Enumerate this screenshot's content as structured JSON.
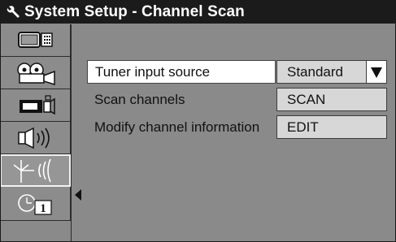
{
  "window": {
    "title": "System Setup - Channel Scan",
    "title_icon": "wrench-icon"
  },
  "sidebar": {
    "items": [
      {
        "name": "display-setup",
        "icon": "tv-screen-icon",
        "active": false
      },
      {
        "name": "projector-setup",
        "icon": "projector-icon",
        "active": false
      },
      {
        "name": "video-source",
        "icon": "camera-icon",
        "active": false
      },
      {
        "name": "audio-setup",
        "icon": "speaker-icon",
        "active": false
      },
      {
        "name": "antenna-setup",
        "icon": "antenna-icon",
        "active": true
      },
      {
        "name": "timer-setup",
        "icon": "clock-icon",
        "active": false,
        "badge": "1"
      }
    ]
  },
  "settings": {
    "rows": [
      {
        "label": "Tuner input source",
        "value": "Standard",
        "control": "dropdown",
        "selected": true
      },
      {
        "label": "Scan channels",
        "value": "SCAN",
        "control": "button",
        "selected": false
      },
      {
        "label": "Modify channel information",
        "value": "EDIT",
        "control": "button",
        "selected": false
      }
    ]
  },
  "colors": {
    "titlebar_bg": "#1b1b1b",
    "panel_bg": "#8a8a8a",
    "value_bg": "#d7d7d7",
    "selected_bg": "#ffffff"
  }
}
